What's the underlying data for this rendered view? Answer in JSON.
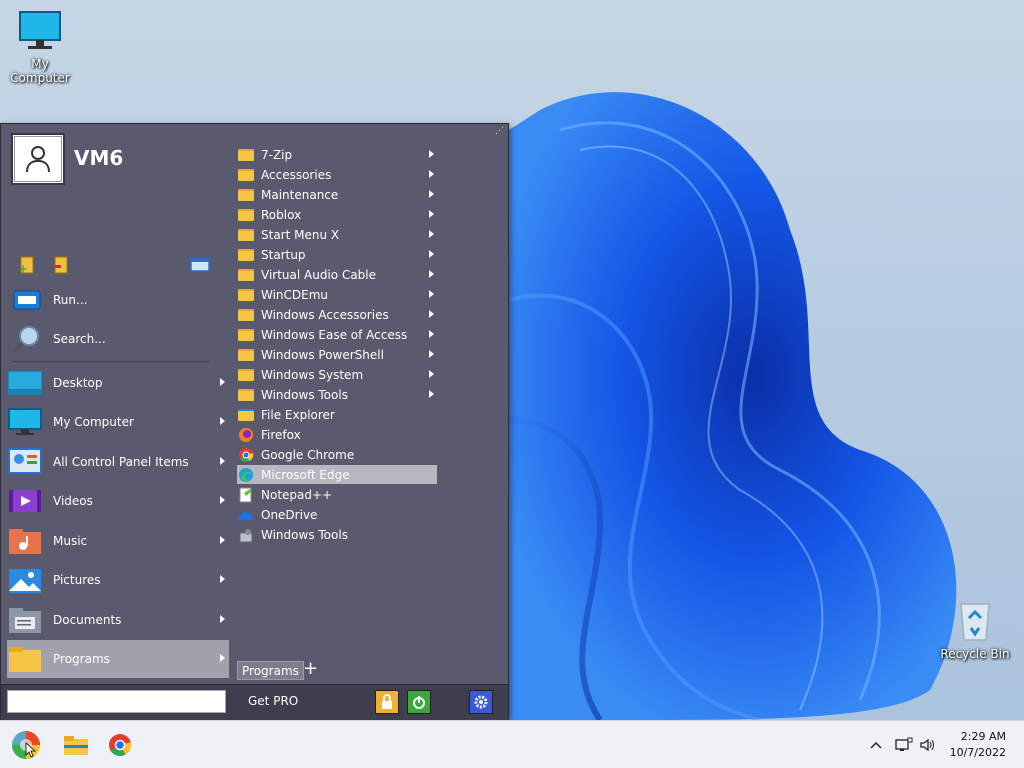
{
  "desktop": {
    "icons": [
      {
        "label": "My Computer"
      },
      {
        "label": "Recycle Bin"
      }
    ]
  },
  "start_menu": {
    "username": "VM6",
    "commands": [
      {
        "label": "Run..."
      },
      {
        "label": "Search..."
      }
    ],
    "folders": [
      {
        "label": "Desktop"
      },
      {
        "label": "My Computer"
      },
      {
        "label": "All Control Panel Items"
      },
      {
        "label": "Videos"
      },
      {
        "label": "Music"
      },
      {
        "label": "Pictures"
      },
      {
        "label": "Documents"
      },
      {
        "label": "Programs"
      }
    ],
    "programs": [
      {
        "label": "7-Zip",
        "submenu": true
      },
      {
        "label": "Accessories",
        "submenu": true
      },
      {
        "label": "Maintenance",
        "submenu": true
      },
      {
        "label": "Roblox",
        "submenu": true
      },
      {
        "label": "Start Menu X",
        "submenu": true
      },
      {
        "label": "Startup",
        "submenu": true
      },
      {
        "label": "Virtual Audio Cable",
        "submenu": true
      },
      {
        "label": "WinCDEmu",
        "submenu": true
      },
      {
        "label": "Windows Accessories",
        "submenu": true
      },
      {
        "label": "Windows Ease of Access",
        "submenu": true
      },
      {
        "label": "Windows PowerShell",
        "submenu": true
      },
      {
        "label": "Windows System",
        "submenu": true
      },
      {
        "label": "Windows Tools",
        "submenu": true
      },
      {
        "label": "File Explorer",
        "submenu": false
      },
      {
        "label": "Firefox",
        "submenu": false
      },
      {
        "label": "Google Chrome",
        "submenu": false
      },
      {
        "label": "Microsoft Edge",
        "submenu": false
      },
      {
        "label": "Notepad++",
        "submenu": false
      },
      {
        "label": "OneDrive",
        "submenu": false
      },
      {
        "label": "Windows Tools",
        "submenu": false
      }
    ],
    "programs_tab": "Programs",
    "plus_tab": "+",
    "search_value": "",
    "get_pro": "Get PRO"
  },
  "taskbar": {
    "time": "2:29 AM",
    "date": "10/7/2022"
  },
  "colors": {
    "menu_bg": "#5a5a6e",
    "highlight": "#b7b7c1",
    "accent_blue": "#1a5fe0"
  }
}
